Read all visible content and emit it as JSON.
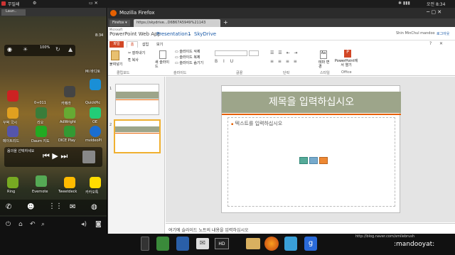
{
  "statusbar": {
    "left_label": "무밀쇄",
    "time": "오전 8:34"
  },
  "phone": {
    "top_tab": "Laun..",
    "clock": "8:34",
    "quick_pct": "100%",
    "mini_clock": "8:34",
    "apps_row1": [
      "0+011",
      "카메라",
      "",
      "QuickPic"
    ],
    "apps_row2": [
      "꾸벅 국시",
      "리오",
      "AdWright",
      "OE"
    ],
    "apps_row3": [
      "메이트리드",
      "Daum 지도",
      "DICE Play",
      "mvideoPl"
    ],
    "music_label": "음의을 선택하세요",
    "apps_row4": [
      "Ring",
      "Evernote",
      "Tweetdeck",
      "카카오톡"
    ],
    "ps_label": "Mi 바디토"
  },
  "firefox": {
    "title": "Mozilla Firefox",
    "menu_btn": "Firefox",
    "tab_label": "https://skydrive...D6B67A5949%21143",
    "new_tab": "+",
    "app_brand": "Microsoft",
    "app_name": "PowerPoint Web App",
    "doc_name": "Presentation1",
    "sep": "–",
    "service": "SkyDrive",
    "user": "Shin MinChul mandoo",
    "signout": "로그아웃",
    "ribbon_tabs": [
      "파일",
      "홈",
      "삽입",
      "보기"
    ],
    "ribbon": {
      "paste": "붙여넣기",
      "cut": "잘라내기",
      "copy": "복사",
      "new_slide": "새 슬라이드",
      "del_slide": "슬라이드 삭제",
      "dup_slide": "슬라이드 복제",
      "hide_slide": "슬라이드 숨기기",
      "open_ppt": "PowerPoint에서 열기",
      "group_clip": "클립보드",
      "group_slide": "슬라이드",
      "group_font": "글꼴",
      "group_para": "단락",
      "group_style": "스타일",
      "group_office": "Office",
      "style_btn": "테마 변경"
    },
    "thumbs": [
      "1",
      "2"
    ],
    "slide_title": "제목을 입력하십시오",
    "slide_body": "텍스트를 입력하십시오",
    "notes_placeholder": "여기에 슬라이드 노트의 내용을 입력하십시오"
  },
  "taskbar": {
    "hd": "HD",
    "url": "http://blog.naver.com/smilebrush",
    "signature": ":mandooyat:"
  },
  "colors": {
    "accent": "#d24726",
    "title_band": "#9da58a",
    "firefox_orange": "#e66000"
  }
}
